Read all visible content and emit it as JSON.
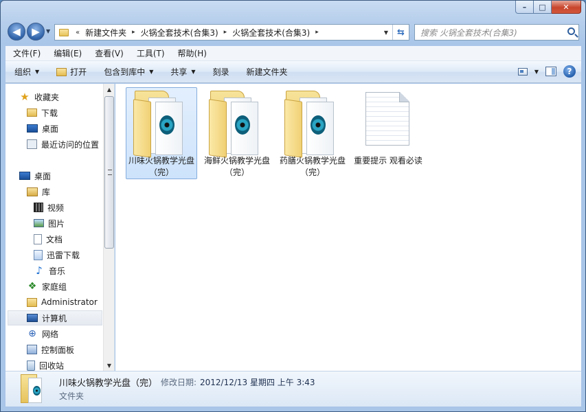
{
  "window": {
    "buttons": {
      "minimize": "–",
      "maximize": "□",
      "close": "✕"
    }
  },
  "address": {
    "chevrons": "«",
    "crumbs": [
      "新建文件夹",
      "火锅全套技术(合集3)",
      "火锅全套技术(合集3)"
    ],
    "separator": "▸"
  },
  "search": {
    "placeholder": "搜索 火锅全套技术(合集3)"
  },
  "menu": [
    "文件(F)",
    "编辑(E)",
    "查看(V)",
    "工具(T)",
    "帮助(H)"
  ],
  "toolbar": {
    "organize": "组织",
    "open": "打开",
    "include_in_library": "包含到库中",
    "share": "共享",
    "burn": "刻录",
    "new_folder": "新建文件夹"
  },
  "nav": {
    "favorites": "收藏夹",
    "downloads": "下载",
    "desktop_fav": "桌面",
    "recent": "最近访问的位置",
    "desktop": "桌面",
    "libraries": "库",
    "videos": "视频",
    "pictures": "图片",
    "documents": "文档",
    "xunlei": "迅雷下载",
    "music": "音乐",
    "homegroup": "家庭组",
    "admin": "Administrator",
    "computer": "计算机",
    "network": "网络",
    "control_panel": "控制面板",
    "recycle_bin": "回收站"
  },
  "items": [
    {
      "name": "川味火锅教学光盘（完）",
      "type": "folder",
      "selected": true
    },
    {
      "name": "海鲜火锅教学光盘（完）",
      "type": "folder",
      "selected": false
    },
    {
      "name": "药膳火锅教学光盘（完）",
      "type": "folder",
      "selected": false
    },
    {
      "name": "重要提示 观看必读",
      "type": "text",
      "selected": false
    }
  ],
  "details": {
    "name": "川味火锅教学光盘（完）",
    "modified_label": "修改日期:",
    "modified_value": "2012/12/13 星期四 上午 3:43",
    "type": "文件夹"
  },
  "colors": {
    "selection": "#cde3fb",
    "accent": "#2f62a8"
  }
}
